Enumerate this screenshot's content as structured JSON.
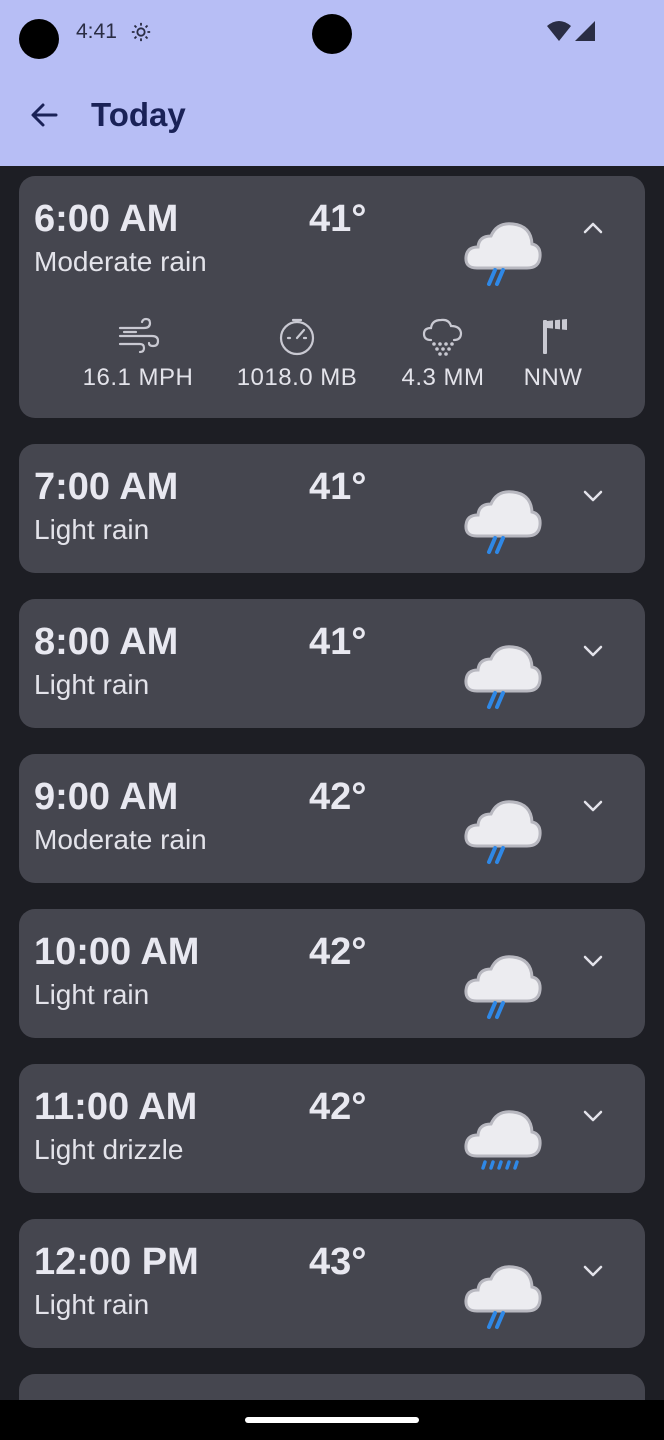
{
  "status_bar": {
    "time": "4:41"
  },
  "app_bar": {
    "title": "Today"
  },
  "colors": {
    "rain": "#2f88e6",
    "cloud": "#ececf0",
    "card": "#45464f",
    "app_bar": "#b7bef5"
  },
  "forecast": [
    {
      "hour": "6:00 AM",
      "condition": "Moderate rain",
      "temp": "41°",
      "icon": "rain-cloud-icon",
      "expanded": true,
      "details": {
        "wind": "16.1 MPH",
        "pressure": "1018.0 MB",
        "precip": "4.3 MM",
        "direction": "NNW"
      }
    },
    {
      "hour": "7:00 AM",
      "condition": "Light rain",
      "temp": "41°",
      "icon": "rain-cloud-icon",
      "expanded": false
    },
    {
      "hour": "8:00 AM",
      "condition": "Light rain",
      "temp": "41°",
      "icon": "rain-cloud-icon",
      "expanded": false
    },
    {
      "hour": "9:00 AM",
      "condition": "Moderate rain",
      "temp": "42°",
      "icon": "rain-cloud-icon",
      "expanded": false
    },
    {
      "hour": "10:00 AM",
      "condition": "Light rain",
      "temp": "42°",
      "icon": "rain-cloud-icon",
      "expanded": false
    },
    {
      "hour": "11:00 AM",
      "condition": "Light drizzle",
      "temp": "42°",
      "icon": "drizzle-cloud-icon",
      "expanded": false
    },
    {
      "hour": "12:00 PM",
      "condition": "Light rain",
      "temp": "43°",
      "icon": "rain-cloud-icon",
      "expanded": false
    }
  ]
}
